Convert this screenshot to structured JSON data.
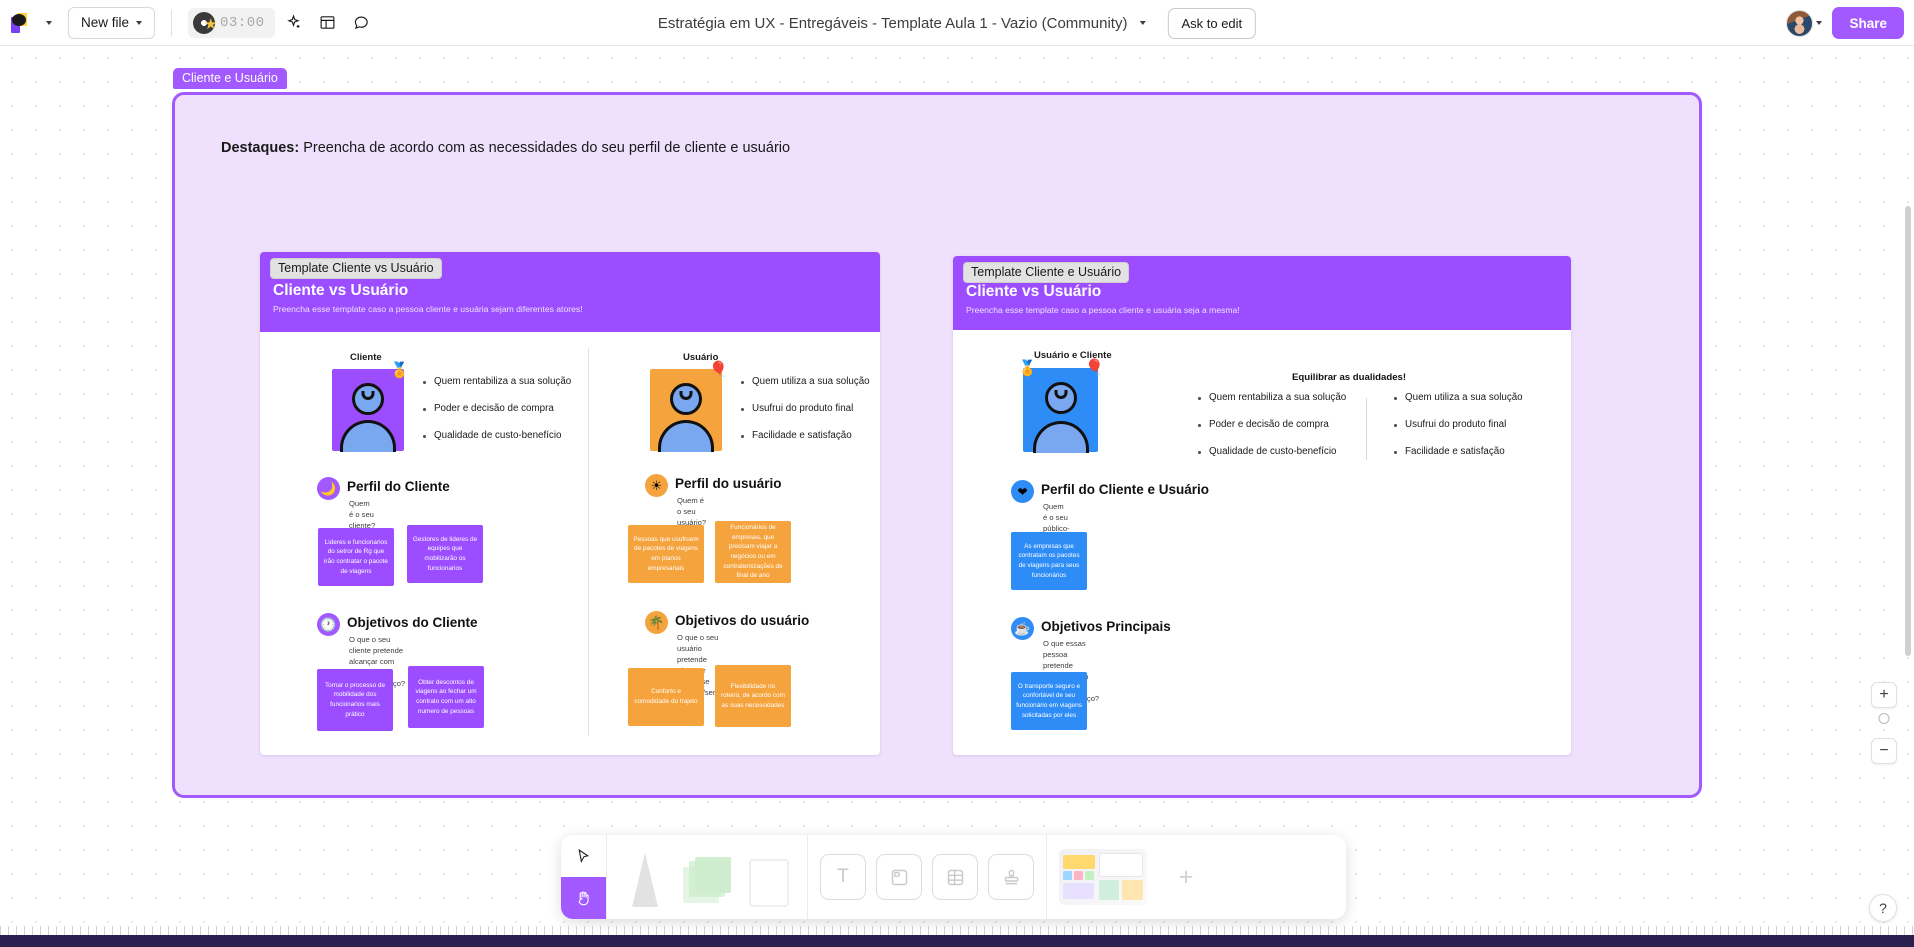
{
  "topbar": {
    "logo_name": "miro-logo",
    "new_file_label": "New file",
    "timer_value": "03:00",
    "doc_title": "Estratégia em UX - Entregáveis - Template Aula 1 - Vazio (Community)",
    "ask_to_edit_label": "Ask to edit",
    "share_label": "Share",
    "icons": [
      "sparkle-icon",
      "layout-icon",
      "comment-icon"
    ],
    "accent_color": "#a259ff"
  },
  "frame": {
    "tag": "Cliente e Usuário",
    "destaques_label": "Destaques:",
    "destaques_text": " Preencha de acordo com as necessidades do seu perfil de cliente e usuário",
    "border_color": "#a259ff",
    "fill_color": "#efe0fd"
  },
  "card_left": {
    "tag": "Template Cliente vs Usuário",
    "title": "Cliente vs Usuário",
    "subtitle": "Preencha esse template caso a pessoa cliente e usuária sejam diferentes atores!",
    "header_color": "#9b4dff",
    "cliente": {
      "label": "Cliente",
      "badge": "🏅",
      "tile_color": "#9b4dff",
      "bullets": [
        "Quem rentabiliza a sua solução",
        "Poder e decisão de compra",
        "Qualidade de custo-benefício"
      ]
    },
    "usuario": {
      "label": "Usuário",
      "badge": "🎈",
      "tile_color": "#f5a33c",
      "bullets": [
        "Quem utiliza a sua solução",
        "Usufrui do produto final",
        "Facilidade e satisfação"
      ]
    },
    "perfil_cliente": {
      "icon": "🌙",
      "icon_bg": "#a259ff",
      "title": "Perfil do Cliente",
      "subtitle": "Quem é o seu cliente?",
      "notes": [
        "Lideres e funcionarios do setror de Rg que irão contratar o pacote de viagens",
        "Gestores de lideres de equipes que mobilizarão os funcionarios"
      ]
    },
    "perfil_usuario": {
      "icon": "☀",
      "icon_bg": "#f5a33c",
      "title": "Perfil do usuário",
      "subtitle": "Quem é o seu usuário?",
      "notes": [
        "Pessoas que usufruem de pacotes de viagens em planos empresariais",
        "Funcionários de empresas, que precisam viajar a negócios ou em contraternizações de final de ano"
      ]
    },
    "objetivos_cliente": {
      "icon": "🕐",
      "icon_bg": "#a259ff",
      "title": "Objetivos do Cliente",
      "subtitle_l1": "O que o seu cliente pretende",
      "subtitle_l2": "alcançar com esse produto/serviço?",
      "notes": [
        "Tornar o processo de mobilidade dos funcionarios mais prático",
        "Obter descontos de viagens ao fechar um contrato com um alto numero de pessoas"
      ]
    },
    "objetivos_usuario": {
      "icon": "🌴",
      "icon_bg": "#f5a33c",
      "title": "Objetivos do usuário",
      "subtitle_l1": "O que o seu usuário pretende alcançar",
      "subtitle_l2": "com esse produto/serviço?",
      "notes": [
        "Conforto e comodidade do trajeto",
        "Flexibilidade no roteiro, de acordo com as suas necessidades"
      ]
    }
  },
  "card_right": {
    "tag": "Template Cliente e Usuário",
    "title": "Cliente vs Usuário",
    "subtitle": "Preencha esse template caso a pessoa cliente e usuária seja a mesma!",
    "header_color": "#9b4dff",
    "persona": {
      "label": "Usuário e Cliente",
      "badge_left": "🏅",
      "badge_right": "🎈",
      "tile_color": "#2e8cf7"
    },
    "dualidades": {
      "title": "Equilibrar as dualidades!",
      "left_bullets": [
        "Quem rentabiliza a sua solução",
        "Poder e decisão de compra",
        "Qualidade de custo-benefício"
      ],
      "right_bullets": [
        "Quem utiliza a sua solução",
        "Usufrui do produto final",
        "Facilidade e satisfação"
      ]
    },
    "perfil": {
      "icon": "❤",
      "icon_bg": "#2e8cf7",
      "title": "Perfil do Cliente e Usuário",
      "subtitle": "Quem é o seu público-alvo?",
      "notes": [
        "As empresas que contratam os pacotes de viagens para seus funcionários"
      ]
    },
    "objetivos": {
      "icon": "☕",
      "icon_bg": "#2e8cf7",
      "title": "Objetivos Principais",
      "subtitle_l1": "O que essas pessoa pretende",
      "subtitle_l2": "alcançar com esse produto/serviço?",
      "notes": [
        "O transporte seguro e confortável de seu funcionário em viagens solicitadas por eles"
      ]
    }
  },
  "toolbar_bottom": {
    "items": [
      "cursor-select-tool",
      "hand-pan-tool",
      "pen-tool",
      "sticky-note-tool",
      "shapes-tool",
      "text-tool",
      "frame-tool",
      "table-tool",
      "stamp-tool",
      "templates-tool",
      "more-apps-tool"
    ],
    "text_glyph": "T",
    "plus_glyph": "+",
    "active_tool": "hand-pan-tool",
    "active_color": "#a259ff"
  },
  "zoom_controls": {
    "zoom_in": "+",
    "zoom_out": "−",
    "help": "?"
  }
}
